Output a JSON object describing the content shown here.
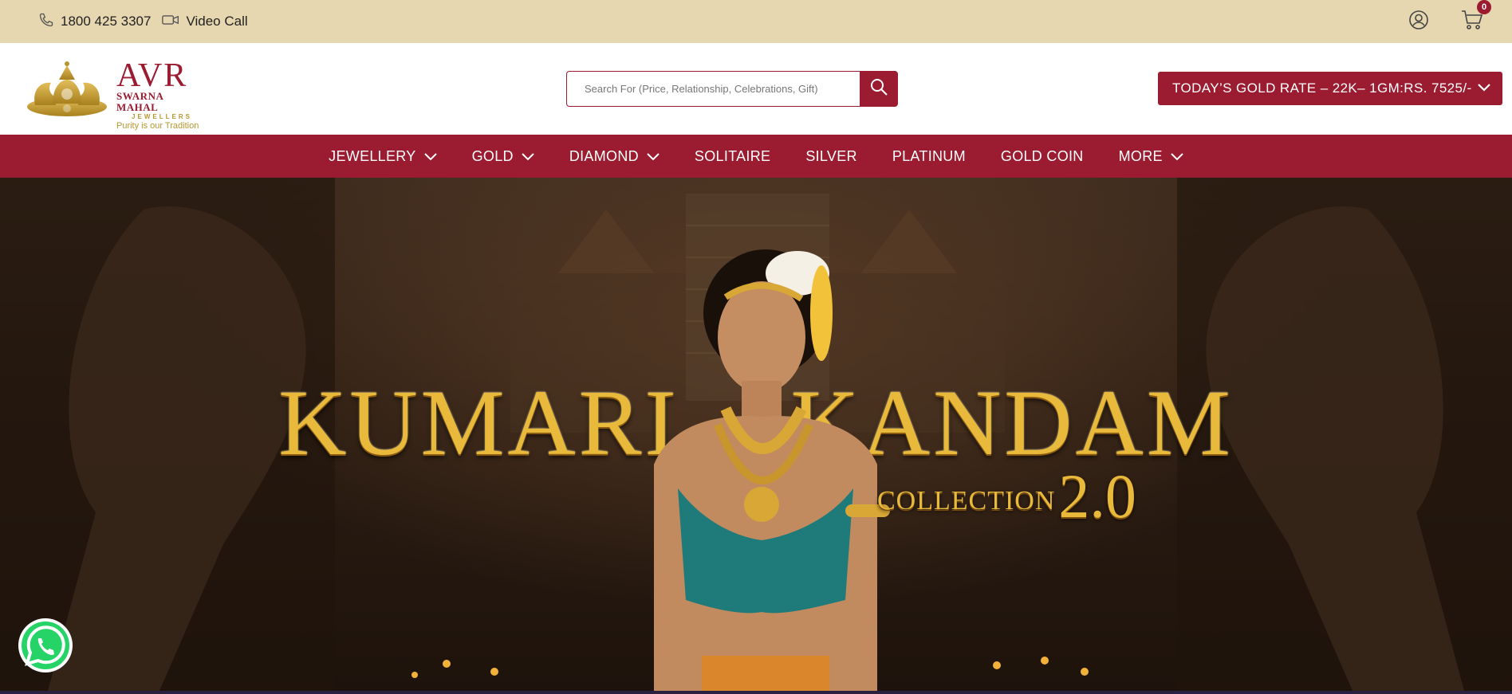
{
  "topbar": {
    "phone": "1800 425 3307",
    "video_call": "Video Call",
    "cart_count": "0",
    "icons": [
      "phone-icon",
      "video-icon",
      "user-icon",
      "cart-icon"
    ]
  },
  "header": {
    "logo": {
      "name": "AVR",
      "subtitle": "SWARNA MAHAL",
      "jewellers": "JEWELLERS",
      "tagline": "Purity is our Tradition"
    },
    "search": {
      "placeholder": "Search For (Price, Relationship, Celebrations, Gift)"
    },
    "gold_rate": "TODAY’S GOLD RATE – 22K– 1GM:RS. 7525/-"
  },
  "nav": {
    "items": [
      {
        "label": "JEWELLERY",
        "dropdown": true
      },
      {
        "label": "GOLD",
        "dropdown": true
      },
      {
        "label": "DIAMOND",
        "dropdown": true
      },
      {
        "label": "SOLITAIRE",
        "dropdown": false
      },
      {
        "label": "SILVER",
        "dropdown": false
      },
      {
        "label": "PLATINUM",
        "dropdown": false
      },
      {
        "label": "GOLD COIN",
        "dropdown": false
      },
      {
        "label": "MORE",
        "dropdown": true
      }
    ]
  },
  "hero": {
    "title_left": "KUMARI",
    "title_right": "KANDAM",
    "collection": "COLLECTION",
    "version": "2.0"
  },
  "colors": {
    "topbar_bg": "#e6d7b0",
    "brand_maroon": "#9b1b30",
    "gold": "#e8b93a",
    "whatsapp_green": "#25d366"
  }
}
